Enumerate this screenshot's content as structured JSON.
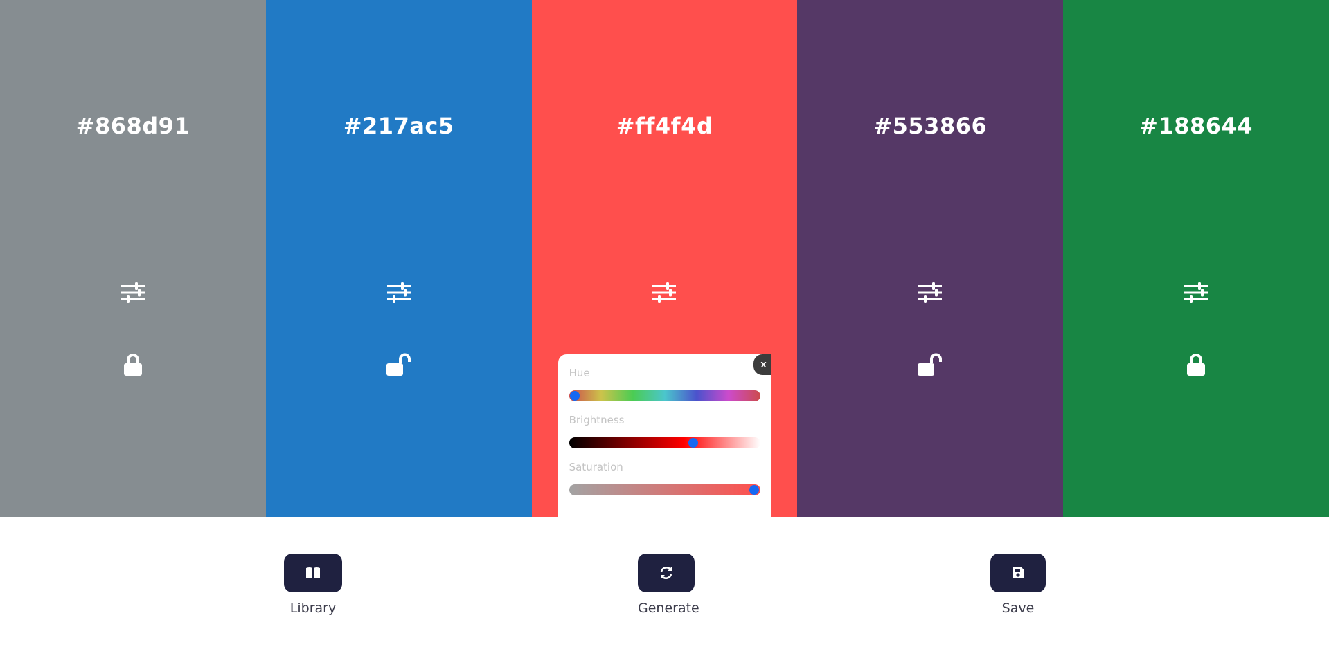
{
  "colors": {
    "text": "#ffffff",
    "toolbar_button": "#1f2140",
    "slider_thumb": "#1668f2"
  },
  "swatches": [
    {
      "hex": "#868d91",
      "background": "#868d91",
      "lock_state": "locked",
      "adjust_icon": "sliders-icon"
    },
    {
      "hex": "#217ac5",
      "background": "#217ac5",
      "lock_state": "unlocked",
      "adjust_icon": "sliders-icon"
    },
    {
      "hex": "#ff4f4d",
      "background": "#ff4f4d",
      "lock_state": "hidden",
      "adjust_icon": "sliders-icon"
    },
    {
      "hex": "#553866",
      "background": "#553866",
      "lock_state": "unlocked",
      "adjust_icon": "sliders-icon"
    },
    {
      "hex": "#188644",
      "background": "#188644",
      "lock_state": "locked",
      "adjust_icon": "sliders-icon"
    }
  ],
  "adjust_panel": {
    "open_on_swatch": 2,
    "close_label": "x",
    "sliders": [
      {
        "label": "Hue",
        "value_fraction": 0.03
      },
      {
        "label": "Brightness",
        "value_fraction": 0.65
      },
      {
        "label": "Saturation",
        "value_fraction": 0.97
      }
    ]
  },
  "toolbar": {
    "library": {
      "label": "Library",
      "icon": "book-icon"
    },
    "generate": {
      "label": "Generate",
      "icon": "refresh-icon"
    },
    "save": {
      "label": "Save",
      "icon": "floppy-disk-icon"
    }
  }
}
